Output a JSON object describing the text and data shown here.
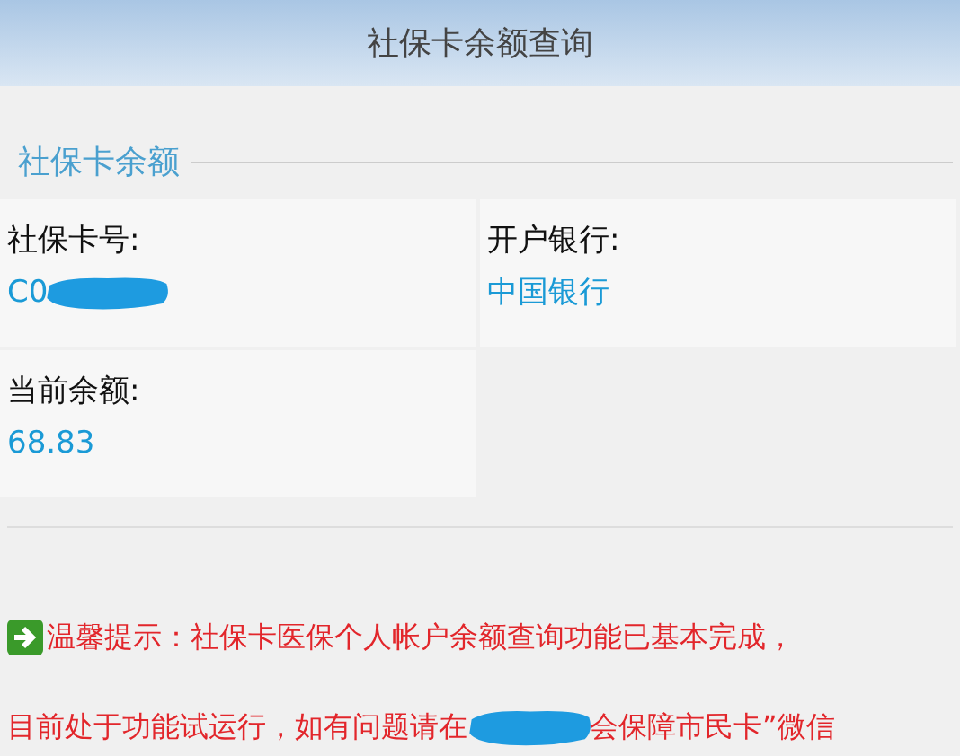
{
  "header": {
    "title": "社保卡余额查询"
  },
  "section": {
    "legend": "社保卡余额"
  },
  "fields": [
    {
      "label": "社保卡号:",
      "value": "C0",
      "redacted": true
    },
    {
      "label": "开户银行:",
      "value": "中国银行",
      "redacted": false
    },
    {
      "label": "当前余额:",
      "value": "68.83",
      "redacted": false
    }
  ],
  "notice": {
    "lines": [
      {
        "text": "温馨提示：社保卡医保个人帐户余额查询功能已基本完成，",
        "icon": true
      },
      {
        "text": "目前处于功能试运行，如有问题请在",
        "after": "会保障市民卡”微信",
        "icon": false
      }
    ]
  }
}
